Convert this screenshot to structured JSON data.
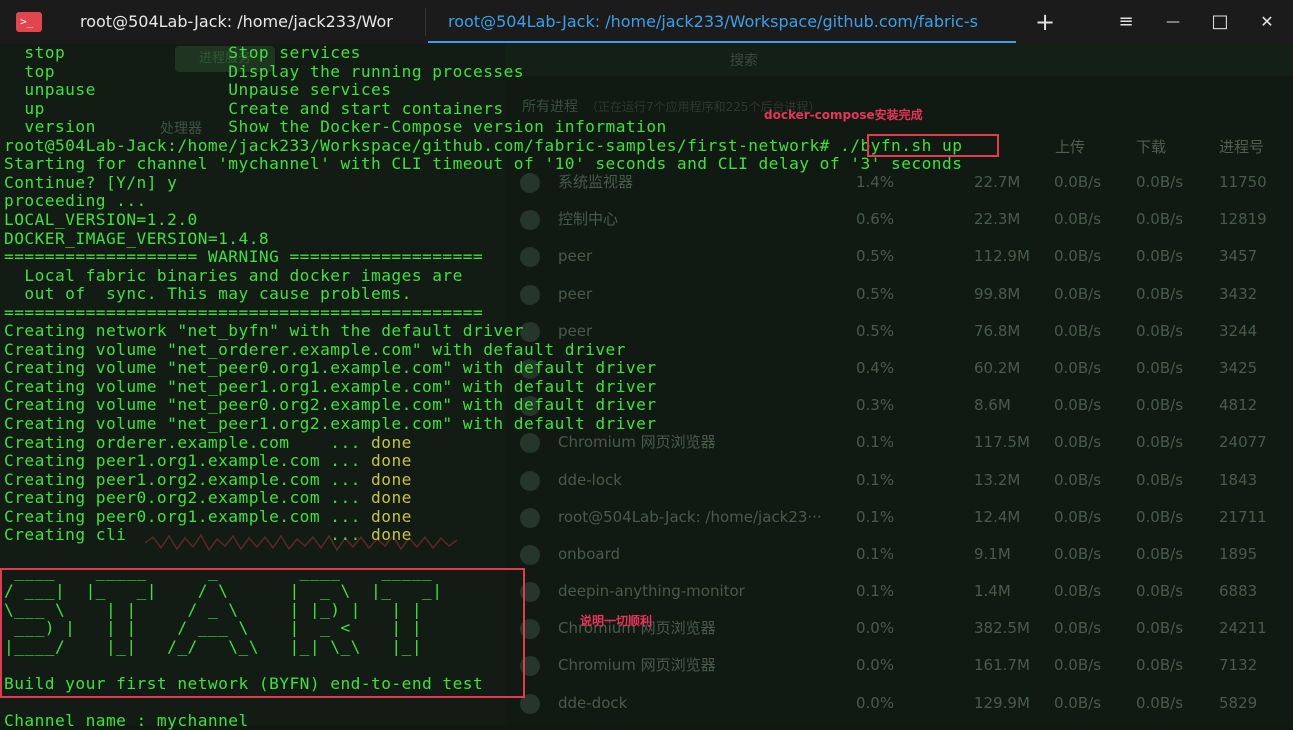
{
  "window": {
    "tab1_title": "root@504Lab-Jack: /home/jack233/Wor",
    "tab2_title": "root@504Lab-Jack: /home/jack233/Workspace/github.com/fabric-s",
    "new_tab_symbol": "+",
    "menu_symbol": "≡",
    "minimize_symbol": "—",
    "maximize_symbol": "□",
    "close_symbol": "✕"
  },
  "background_app": {
    "search_placeholder": "搜索",
    "tag_label": "进程服务",
    "section_title": "所有进程",
    "section_subtitle": "（正在运行7个应用程序和225个后台进程）",
    "cpu_label": "处理器",
    "columns": [
      "上传",
      "下载",
      "进程号"
    ],
    "processes": [
      {
        "name": "系统监视器",
        "cpu": "1.4%",
        "mem": "22.7M",
        "up": "0.0B/s",
        "down": "0.0B/s",
        "pid": "11750"
      },
      {
        "name": "控制中心",
        "cpu": "0.6%",
        "mem": "22.3M",
        "up": "0.0B/s",
        "down": "0.0B/s",
        "pid": "12819"
      },
      {
        "name": "peer",
        "cpu": "0.5%",
        "mem": "112.9M",
        "up": "0.0B/s",
        "down": "0.0B/s",
        "pid": "3457"
      },
      {
        "name": "peer",
        "cpu": "0.5%",
        "mem": "99.8M",
        "up": "0.0B/s",
        "down": "0.0B/s",
        "pid": "3432"
      },
      {
        "name": "peer",
        "cpu": "0.5%",
        "mem": "76.8M",
        "up": "0.0B/s",
        "down": "0.0B/s",
        "pid": "3244"
      },
      {
        "name": "",
        "cpu": "0.4%",
        "mem": "60.2M",
        "up": "0.0B/s",
        "down": "0.0B/s",
        "pid": "3425"
      },
      {
        "name": "",
        "cpu": "0.3%",
        "mem": "8.6M",
        "up": "0.0B/s",
        "down": "0.0B/s",
        "pid": "4812"
      },
      {
        "name": "Chromium 网页浏览器",
        "cpu": "0.1%",
        "mem": "117.5M",
        "up": "0.0B/s",
        "down": "0.0B/s",
        "pid": "24077"
      },
      {
        "name": "dde-lock",
        "cpu": "0.1%",
        "mem": "13.2M",
        "up": "0.0B/s",
        "down": "0.0B/s",
        "pid": "1843"
      },
      {
        "name": "root@504Lab-Jack: /home/jack23···",
        "cpu": "0.1%",
        "mem": "12.4M",
        "up": "0.0B/s",
        "down": "0.0B/s",
        "pid": "21711"
      },
      {
        "name": "onboard",
        "cpu": "0.1%",
        "mem": "9.1M",
        "up": "0.0B/s",
        "down": "0.0B/s",
        "pid": "1895"
      },
      {
        "name": "deepin-anything-monitor",
        "cpu": "0.1%",
        "mem": "1.4M",
        "up": "0.0B/s",
        "down": "0.0B/s",
        "pid": "6883"
      },
      {
        "name": "Chromium 网页浏览器",
        "cpu": "0.0%",
        "mem": "382.5M",
        "up": "0.0B/s",
        "down": "0.0B/s",
        "pid": "24211"
      },
      {
        "name": "Chromium 网页浏览器",
        "cpu": "0.0%",
        "mem": "161.7M",
        "up": "0.0B/s",
        "down": "0.0B/s",
        "pid": "7132"
      },
      {
        "name": "dde-dock",
        "cpu": "0.0%",
        "mem": "129.9M",
        "up": "0.0B/s",
        "down": "0.0B/s",
        "pid": "5829"
      }
    ]
  },
  "terminal": {
    "lines": [
      {
        "text": "  stop                Stop services"
      },
      {
        "text": "  top                 Display the running processes"
      },
      {
        "text": "  unpause             Unpause services"
      },
      {
        "text": "  up                  Create and start containers"
      },
      {
        "text": "  version             Show the Docker-Compose version information"
      },
      {
        "text": "root@504Lab-Jack:/home/jack233/Workspace/github.com/fabric-samples/first-network# ./byfn.sh up"
      },
      {
        "text": "Starting for channel 'mychannel' with CLI timeout of '10' seconds and CLI delay of '3' seconds"
      },
      {
        "text": "Continue? [Y/n] y"
      },
      {
        "text": "proceeding ..."
      },
      {
        "text": "LOCAL_VERSION=1.2.0"
      },
      {
        "text": "DOCKER_IMAGE_VERSION=1.4.8"
      },
      {
        "text": "=================== WARNING ==================="
      },
      {
        "text": "  Local fabric binaries and docker images are"
      },
      {
        "text": "  out of  sync. This may cause problems."
      },
      {
        "text": "==============================================="
      },
      {
        "text": "Creating network \"net_byfn\" with the default driver"
      },
      {
        "text": "Creating volume \"net_orderer.example.com\" with default driver"
      },
      {
        "text": "Creating volume \"net_peer0.org1.example.com\" with default driver"
      },
      {
        "text": "Creating volume \"net_peer1.org1.example.com\" with default driver"
      },
      {
        "text": "Creating volume \"net_peer0.org2.example.com\" with default driver"
      },
      {
        "text": "Creating volume \"net_peer1.org2.example.com\" with default driver"
      },
      {
        "text": "Creating orderer.example.com    ... ",
        "status": "done"
      },
      {
        "text": "Creating peer1.org1.example.com ... ",
        "status": "done"
      },
      {
        "text": "Creating peer1.org2.example.com ... ",
        "status": "done"
      },
      {
        "text": "Creating peer0.org2.example.com ... ",
        "status": "done"
      },
      {
        "text": "Creating peer0.org1.example.com ... ",
        "status": "done"
      },
      {
        "text": "Creating cli                    ... ",
        "status": "done"
      },
      {
        "text": ""
      },
      {
        "text": " ____    _____      _        ____    _____ "
      },
      {
        "text": "/ ___|  |_   _|    / \\      |  _ \\  |_   _|"
      },
      {
        "text": "\\___ \\    | |     / _ \\     | |_) |   | |  "
      },
      {
        "text": " ___) |   | |    / ___ \\    |  _ <    | |  "
      },
      {
        "text": "|____/    |_|   /_/   \\_\\   |_| \\_\\   |_|  "
      },
      {
        "text": ""
      },
      {
        "text": "Build your first network (BYFN) end-to-end test"
      },
      {
        "text": ""
      },
      {
        "text": "Channel name : mychannel"
      }
    ]
  },
  "annotations": {
    "compose_note": "docker-compose安装完成",
    "success_note": "说明一切顺利"
  }
}
